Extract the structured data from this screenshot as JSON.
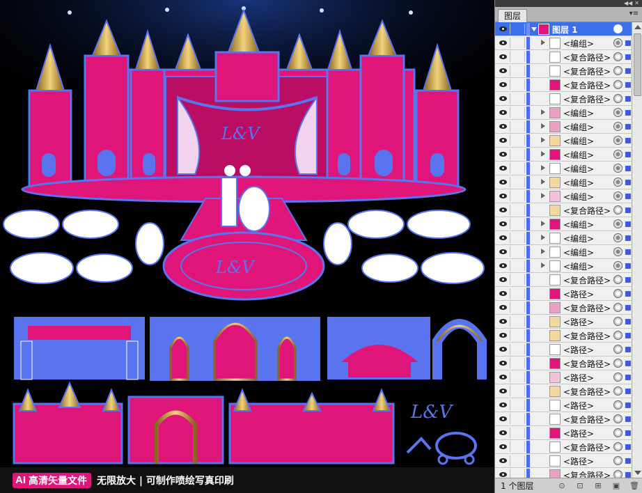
{
  "artboard": {
    "caption": {
      "badge_ai": "AI",
      "badge_text": "高清矢量文件",
      "tagline": "无限放大 | 可制作喷绘写真印刷"
    },
    "colors": {
      "magenta": "#e0157a",
      "blue": "#5a74f0",
      "white": "#ffffff",
      "gold": "#c99a3d",
      "background": "#000000",
      "selection": "#3d6fea"
    }
  },
  "layers_panel": {
    "tab_label": "图层",
    "menu_icon": "panel-menu-icon",
    "top_layer": {
      "name": "图层 1"
    },
    "rows": [
      {
        "name": "<编组>",
        "expandable": true
      },
      {
        "name": "<复合路径>",
        "expandable": false
      },
      {
        "name": "<复合路径>",
        "expandable": false
      },
      {
        "name": "<复合路径>",
        "expandable": false
      },
      {
        "name": "<复合路径>",
        "expandable": false
      },
      {
        "name": "<编组>",
        "expandable": true
      },
      {
        "name": "<编组>",
        "expandable": true
      },
      {
        "name": "<编组>",
        "expandable": true
      },
      {
        "name": "<编组>",
        "expandable": true
      },
      {
        "name": "<编组>",
        "expandable": true
      },
      {
        "name": "<编组>",
        "expandable": true
      },
      {
        "name": "<编组>",
        "expandable": true
      },
      {
        "name": "<复合路径>",
        "expandable": false
      },
      {
        "name": "<编组>",
        "expandable": true
      },
      {
        "name": "<编组>",
        "expandable": true
      },
      {
        "name": "<编组>",
        "expandable": true
      },
      {
        "name": "<编组>",
        "expandable": true
      },
      {
        "name": "<复合路径>",
        "expandable": false
      },
      {
        "name": "<路径>",
        "expandable": false
      },
      {
        "name": "<复合路径>",
        "expandable": false
      },
      {
        "name": "<路径>",
        "expandable": false
      },
      {
        "name": "<复合路径>",
        "expandable": false
      },
      {
        "name": "<路径>",
        "expandable": false
      },
      {
        "name": "<复合路径>",
        "expandable": false
      },
      {
        "name": "<路径>",
        "expandable": false
      },
      {
        "name": "<复合路径>",
        "expandable": false
      },
      {
        "name": "<路径>",
        "expandable": false
      },
      {
        "name": "<复合路径>",
        "expandable": false
      },
      {
        "name": "<路径>",
        "expandable": false
      },
      {
        "name": "<复合路径>",
        "expandable": false
      },
      {
        "name": "<路径>",
        "expandable": false
      },
      {
        "name": "<复合路径>",
        "expandable": false
      },
      {
        "name": "<路径>",
        "expandable": false
      }
    ],
    "footer": {
      "layer_count": "1 个图层"
    }
  }
}
